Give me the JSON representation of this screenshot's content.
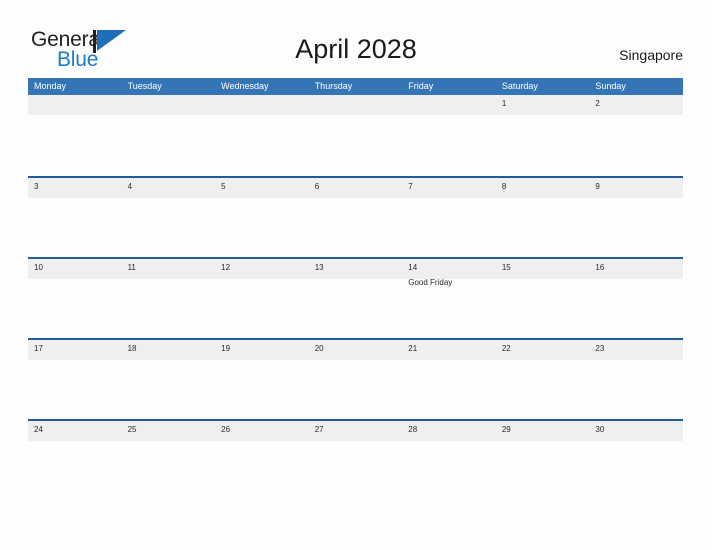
{
  "brand": {
    "name_part1": "General",
    "name_part2": "Blue",
    "flag_icon": "blue-flag-icon"
  },
  "header": {
    "title": "April 2028",
    "locale": "Singapore"
  },
  "colors": {
    "header_blue": "#3575b5",
    "divider_blue": "#1f5c99",
    "band_gray": "#efefef",
    "brand_blue": "#1e7cc4",
    "page_background": "#fdfdfd",
    "text_dark": "#2a2a2a"
  },
  "calendar": {
    "month": "April",
    "year": "2028",
    "weekdays": [
      "Monday",
      "Tuesday",
      "Wednesday",
      "Thursday",
      "Friday",
      "Saturday",
      "Sunday"
    ],
    "weeks": [
      {
        "days": [
          {
            "number": "",
            "events": []
          },
          {
            "number": "",
            "events": []
          },
          {
            "number": "",
            "events": []
          },
          {
            "number": "",
            "events": []
          },
          {
            "number": "",
            "events": []
          },
          {
            "number": "1",
            "events": []
          },
          {
            "number": "2",
            "events": []
          }
        ]
      },
      {
        "days": [
          {
            "number": "3",
            "events": []
          },
          {
            "number": "4",
            "events": []
          },
          {
            "number": "5",
            "events": []
          },
          {
            "number": "6",
            "events": []
          },
          {
            "number": "7",
            "events": []
          },
          {
            "number": "8",
            "events": []
          },
          {
            "number": "9",
            "events": []
          }
        ]
      },
      {
        "days": [
          {
            "number": "10",
            "events": []
          },
          {
            "number": "11",
            "events": []
          },
          {
            "number": "12",
            "events": []
          },
          {
            "number": "13",
            "events": []
          },
          {
            "number": "14",
            "events": [
              "Good Friday"
            ]
          },
          {
            "number": "15",
            "events": []
          },
          {
            "number": "16",
            "events": []
          }
        ]
      },
      {
        "days": [
          {
            "number": "17",
            "events": []
          },
          {
            "number": "18",
            "events": []
          },
          {
            "number": "19",
            "events": []
          },
          {
            "number": "20",
            "events": []
          },
          {
            "number": "21",
            "events": []
          },
          {
            "number": "22",
            "events": []
          },
          {
            "number": "23",
            "events": []
          }
        ]
      },
      {
        "days": [
          {
            "number": "24",
            "events": []
          },
          {
            "number": "25",
            "events": []
          },
          {
            "number": "26",
            "events": []
          },
          {
            "number": "27",
            "events": []
          },
          {
            "number": "28",
            "events": []
          },
          {
            "number": "29",
            "events": []
          },
          {
            "number": "30",
            "events": []
          }
        ]
      }
    ]
  }
}
